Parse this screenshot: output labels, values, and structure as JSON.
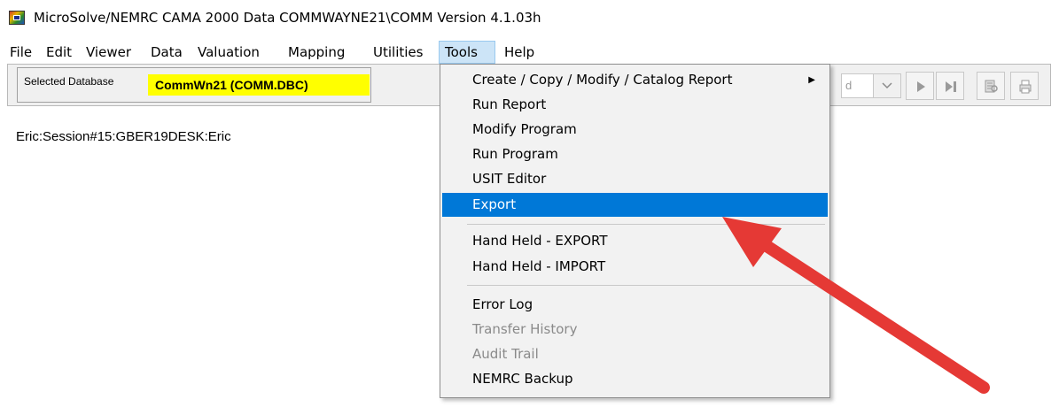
{
  "window": {
    "title": "MicroSolve/NEMRC CAMA 2000  Data COMMWAYNE21\\COMM Version 4.1.03h"
  },
  "menubar": {
    "items": [
      {
        "label": "File"
      },
      {
        "label": "Edit"
      },
      {
        "label": "Viewer"
      },
      {
        "label": "Data"
      },
      {
        "label": "Valuation"
      },
      {
        "label": "Mapping"
      },
      {
        "label": "Utilities"
      },
      {
        "label": "Tools"
      },
      {
        "label": "Help"
      }
    ],
    "active": "Tools"
  },
  "toolbar": {
    "selected_db_label": "Selected Database",
    "selected_db_value": "CommWn21   (COMM.DBC)",
    "combo_partial_text": "d"
  },
  "session": {
    "text": "Eric:Session#15:GBER19DESK:Eric"
  },
  "tools_menu": {
    "items": [
      {
        "label": "Create / Copy / Modify / Catalog Report",
        "submenu": true,
        "state": "normal"
      },
      {
        "label": "Run Report",
        "state": "normal"
      },
      {
        "label": "Modify Program",
        "state": "normal"
      },
      {
        "label": "Run Program",
        "state": "normal"
      },
      {
        "label": "USIT Editor",
        "state": "normal"
      },
      {
        "label": "Export",
        "state": "highlighted"
      },
      {
        "label": "Hand Held - EXPORT",
        "state": "normal"
      },
      {
        "label": "Hand Held - IMPORT",
        "state": "normal"
      },
      {
        "label": "Error Log",
        "state": "normal"
      },
      {
        "label": "Transfer History",
        "state": "disabled"
      },
      {
        "label": "Audit Trail",
        "state": "disabled"
      },
      {
        "label": "NEMRC Backup",
        "state": "normal"
      }
    ],
    "submenu_glyph": "▶"
  },
  "colors": {
    "highlight": "#0078d7",
    "db_highlight": "#ffff00",
    "annotation_arrow": "#e53935"
  },
  "icons": [
    "app-icon",
    "submenu-arrow-icon",
    "combo-dropdown-icon",
    "next-record-icon",
    "last-record-icon",
    "find-icon",
    "print-icon",
    "annotation-arrow"
  ]
}
